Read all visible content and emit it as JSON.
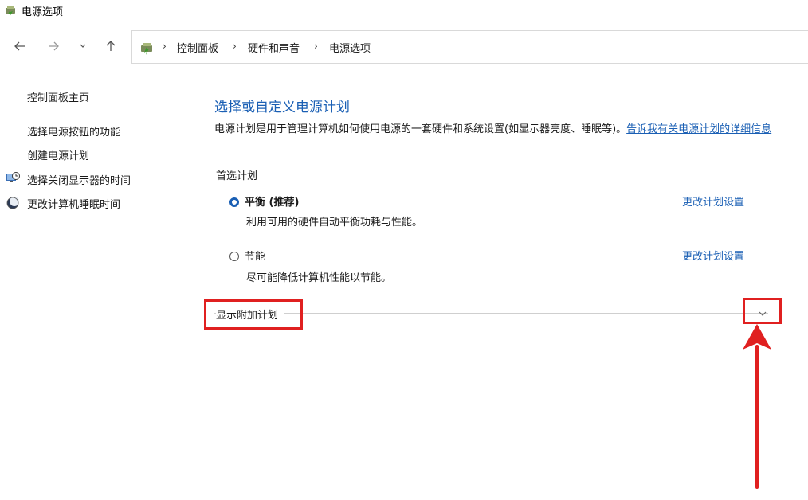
{
  "window": {
    "title": "电源选项",
    "icon": "power-options-icon"
  },
  "nav": {
    "back_icon": "arrow-left-icon",
    "forward_icon": "arrow-right-icon",
    "recent_icon": "chevron-down-icon",
    "up_icon": "arrow-up-icon"
  },
  "breadcrumb": {
    "icon": "control-panel-icon",
    "items": [
      "控制面板",
      "硬件和声音",
      "电源选项"
    ]
  },
  "sidebar": {
    "home": "控制面板主页",
    "items": [
      {
        "label": "选择电源按钮的功能",
        "icon": ""
      },
      {
        "label": "创建电源计划",
        "icon": ""
      },
      {
        "label": "选择关闭显示器的时间",
        "icon": "monitor-clock-icon"
      },
      {
        "label": "更改计算机睡眠时间",
        "icon": "moon-icon"
      }
    ]
  },
  "main": {
    "title": "选择或自定义电源计划",
    "description": "电源计划是用于管理计算机如何使用电源的一套硬件和系统设置(如显示器亮度、睡眠等)。",
    "description_link": "告诉我有关电源计划的详细信息",
    "preferred_label": "首选计划",
    "plans": [
      {
        "name": "平衡 (推荐)",
        "desc": "利用可用的硬件自动平衡功耗与性能。",
        "link": "更改计划设置",
        "selected": true
      },
      {
        "name": "节能",
        "desc": "尽可能降低计算机性能以节能。",
        "link": "更改计划设置",
        "selected": false
      }
    ],
    "additional_label": "显示附加计划",
    "expand_icon": "chevron-down-icon"
  },
  "annotation": {
    "color": "#e02020"
  }
}
